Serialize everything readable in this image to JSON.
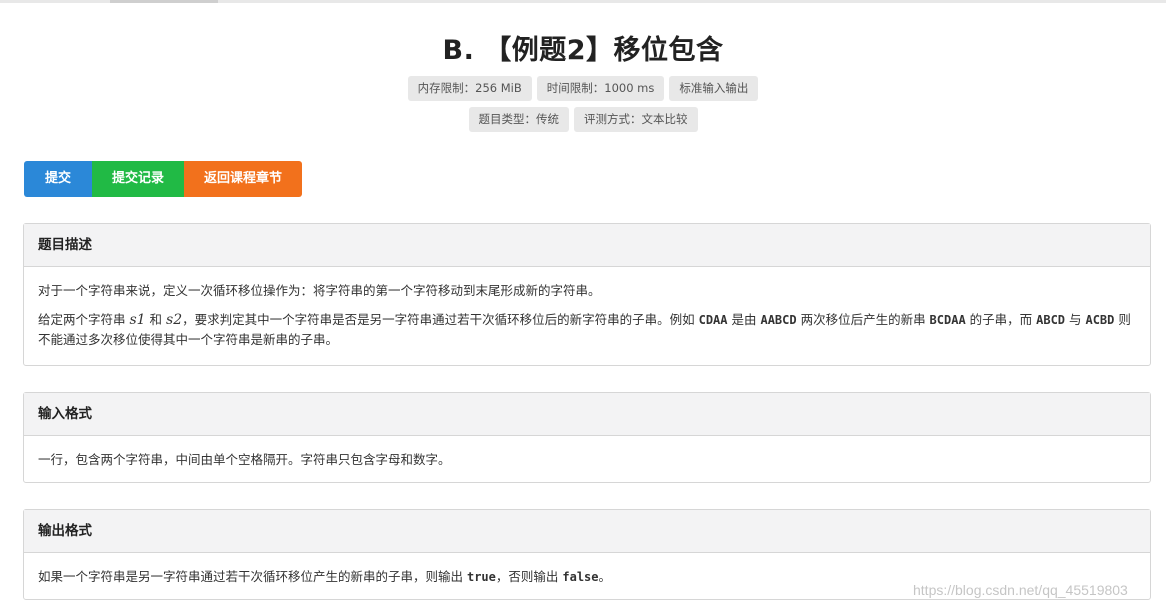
{
  "problem": {
    "title": "B. 【例题2】移位包含",
    "meta_row1": [
      "内存限制：256 MiB",
      "时间限制：1000 ms",
      "标准输入输出"
    ],
    "meta_row2": [
      "题目类型：传统",
      "评测方式：文本比较"
    ]
  },
  "actions": {
    "submit": "提交",
    "records": "提交记录",
    "back": "返回课程章节"
  },
  "colors": {
    "submit": "#2b88d8",
    "records": "#21ba45",
    "back": "#f2711c"
  },
  "sections": {
    "description": {
      "heading": "题目描述",
      "p1": "对于一个字符串来说，定义一次循环移位操作为：将字符串的第一个字符移动到末尾形成新的字符串。",
      "p2_a": "给定两个字符串 ",
      "p2_s1": "s1",
      "p2_b": " 和 ",
      "p2_s2": "s2",
      "p2_c": "，要求判定其中一个字符串是否是另一字符串通过若干次循环移位后的新字符串的子串。例如 ",
      "p2_code1": "CDAA",
      "p2_d": " 是由 ",
      "p2_code2": "AABCD",
      "p2_e": " 两次移位后产生的新串 ",
      "p2_code3": "BCDAA",
      "p2_f": " 的子串，而 ",
      "p2_code4": "ABCD",
      "p2_g": " 与 ",
      "p2_code5": "ACBD",
      "p2_h": " 则不能通过多次移位使得其中一个字符串是新串的子串。"
    },
    "input": {
      "heading": "输入格式",
      "p1": "一行，包含两个字符串，中间由单个空格隔开。字符串只包含字母和数字。"
    },
    "output": {
      "heading": "输出格式",
      "p_a": "如果一个字符串是另一字符串通过若干次循环移位产生的新串的子串，则输出 ",
      "p_true": "true",
      "p_b": "，否则输出 ",
      "p_false": "false",
      "p_c": "。"
    }
  },
  "watermark": "https://blog.csdn.net/qq_45519803"
}
